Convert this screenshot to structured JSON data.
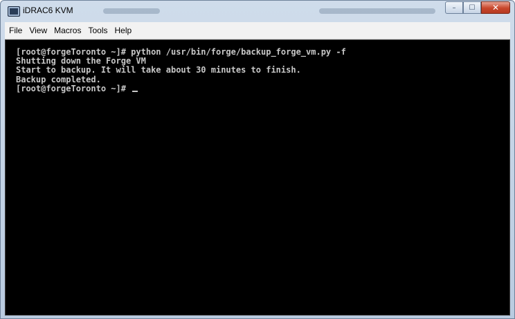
{
  "window": {
    "title": "iDRAC6 KVM",
    "app_icon": "monitor-icon",
    "controls": {
      "minimize_icon": "minimize-icon",
      "maximize_icon": "maximize-icon",
      "close_icon": "close-icon",
      "minimize_glyph": "–",
      "maximize_glyph": "☐",
      "close_glyph": "✕"
    }
  },
  "menubar": {
    "items": [
      {
        "label": "File"
      },
      {
        "label": "View"
      },
      {
        "label": "Macros"
      },
      {
        "label": "Tools"
      },
      {
        "label": "Help"
      }
    ]
  },
  "terminal": {
    "lines": [
      "[root@forgeToronto ~]# python /usr/bin/forge/backup_forge_vm.py -f",
      "Shutting down the Forge VM",
      "Start to backup. It will take about 30 minutes to finish.",
      "Backup completed.",
      "[root@forgeToronto ~]# "
    ],
    "colors": {
      "background": "#000000",
      "foreground": "#c8c8c8"
    }
  }
}
